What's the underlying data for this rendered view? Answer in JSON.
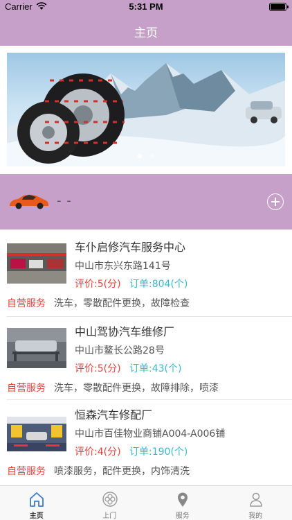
{
  "status_bar": {
    "carrier": "Carrier",
    "time": "5:31 PM"
  },
  "nav": {
    "title": "主页"
  },
  "banner": {
    "dots": 2,
    "active_dot": 0
  },
  "user": {
    "name": "- -"
  },
  "shops": [
    {
      "name": "车仆启修汽车服务中心",
      "address": "中山市东兴东路141号",
      "rating": "评价:5(分)",
      "orders": "订单:804(个)",
      "tag": "自营服务",
      "services": "洗车，零散配件更换，故障检查"
    },
    {
      "name": "中山驾协汽车维修厂",
      "address": "中山市鳌长公路28号",
      "rating": "评价:5(分)",
      "orders": "订单:43(个)",
      "tag": "自营服务",
      "services": "洗车，零散配件更换，故障排除，喷漆"
    },
    {
      "name": "恒森汽车修配厂",
      "address": "中山市百佳物业商铺A004-A006铺",
      "rating": "评价:4(分)",
      "orders": "订单:190(个)",
      "tag": "自营服务",
      "services": "喷漆服务，配件更换，内饰清洗"
    }
  ],
  "tabs": [
    {
      "label": "主页",
      "icon": "home-icon",
      "active": true
    },
    {
      "label": "上门",
      "icon": "flower-icon",
      "active": false
    },
    {
      "label": "服务",
      "icon": "location-pin-icon",
      "active": false
    },
    {
      "label": "我的",
      "icon": "person-icon",
      "active": false
    }
  ],
  "colors": {
    "accent": "#c7a0c9",
    "rating": "#e8413b",
    "orders": "#3cb8c8",
    "tab_active": "#3a7bd5"
  }
}
